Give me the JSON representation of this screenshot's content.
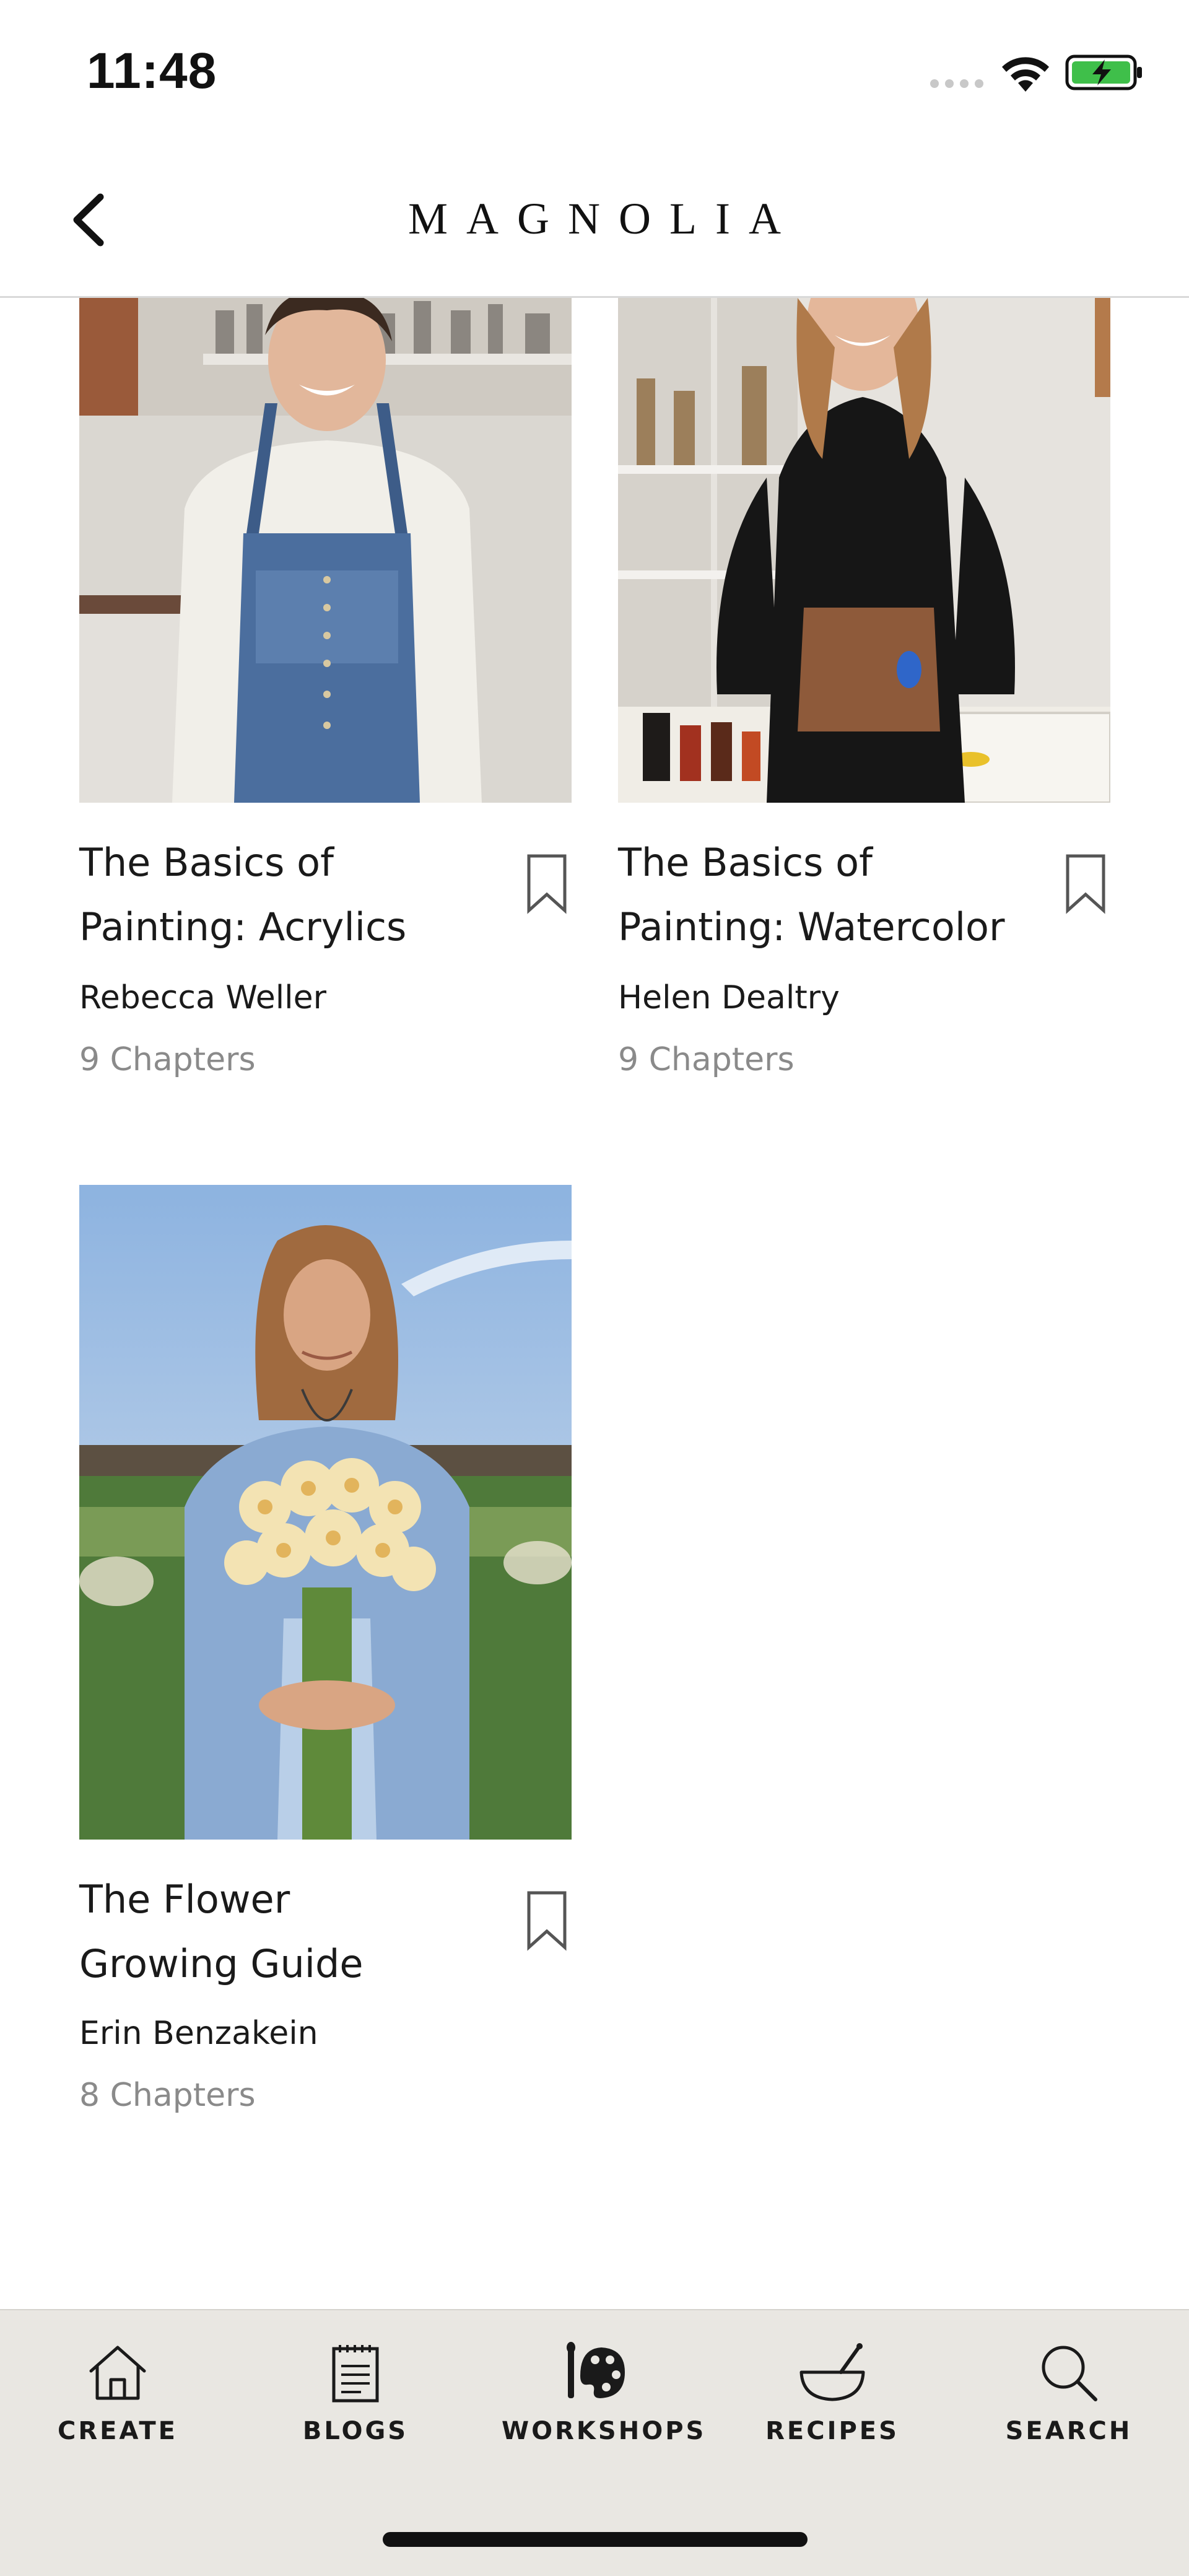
{
  "status_bar": {
    "time": "11:48",
    "battery_color": "#3fbf4a"
  },
  "nav": {
    "title": "MAGNOLIA",
    "back_icon": "chevron-left-icon"
  },
  "workshops": [
    {
      "title": "The Basics of\nPainting: Acrylics",
      "author": "Rebecca Weller",
      "chapters": "9 Chapters",
      "bookmark_icon": "bookmark-icon"
    },
    {
      "title": "The Basics of\nPainting: Watercolor",
      "author": "Helen Dealtry",
      "chapters": "9 Chapters",
      "bookmark_icon": "bookmark-icon"
    },
    {
      "title": "The Flower\nGrowing Guide",
      "author": "Erin Benzakein",
      "chapters": "8 Chapters",
      "bookmark_icon": "bookmark-icon"
    }
  ],
  "tab_bar": {
    "tabs": [
      {
        "label": "CREATE",
        "icon": "house-icon"
      },
      {
        "label": "BLOGS",
        "icon": "notepad-icon"
      },
      {
        "label": "WORKSHOPS",
        "icon": "palette-icon",
        "selected": true
      },
      {
        "label": "RECIPES",
        "icon": "mortar-pestle-icon"
      },
      {
        "label": "SEARCH",
        "icon": "magnifier-icon"
      }
    ],
    "background_color": "#e9e7e2"
  }
}
